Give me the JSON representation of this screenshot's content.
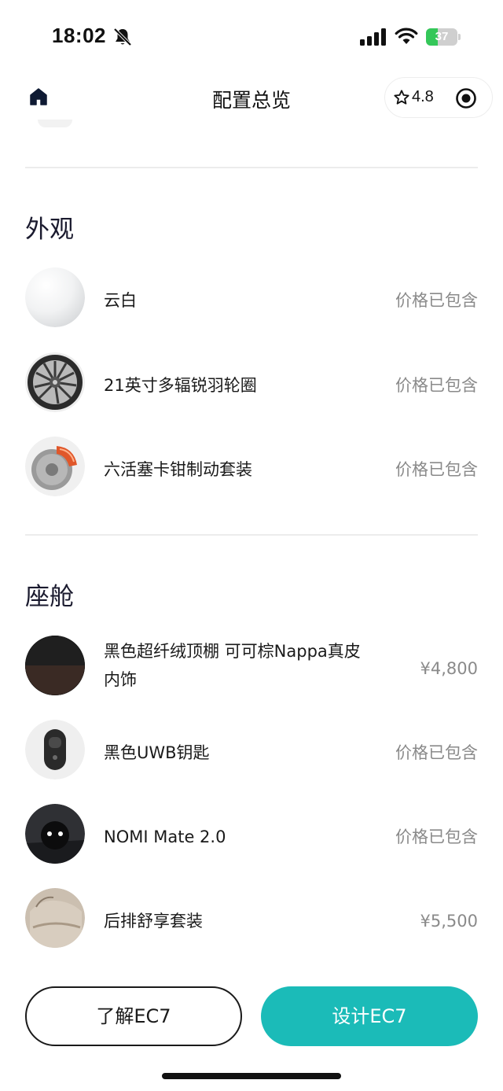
{
  "status_bar": {
    "time": "18:02",
    "battery": "37",
    "battery_level": 0.37
  },
  "nav": {
    "title": "配置总览",
    "rating": "4.8"
  },
  "colors": {
    "accent": "#1bbbb8",
    "price_text": "#8a8a8a"
  },
  "sections": [
    {
      "title": "外观",
      "items": [
        {
          "name": "云白",
          "price": "价格已包含",
          "icon": "white-color-swatch"
        },
        {
          "name": "21英寸多辐锐羽轮圈",
          "price": "价格已包含",
          "icon": "wheel-rim"
        },
        {
          "name": "六活塞卡钳制动套装",
          "price": "价格已包含",
          "icon": "brake-caliper"
        }
      ]
    },
    {
      "title": "座舱",
      "items": [
        {
          "name": "黑色超纤绒顶棚 可可棕Nappa真皮内饰",
          "price": "¥4,800",
          "icon": "interior-swatch"
        },
        {
          "name": "黑色UWB钥匙",
          "price": "价格已包含",
          "icon": "car-key"
        },
        {
          "name": "NOMI Mate 2.0",
          "price": "价格已包含",
          "icon": "nomi-robot"
        },
        {
          "name": "后排舒享套装",
          "price": "¥5,500",
          "icon": "rear-seat"
        }
      ]
    }
  ],
  "buttons": {
    "learn": "了解EC7",
    "design": "设计EC7"
  }
}
